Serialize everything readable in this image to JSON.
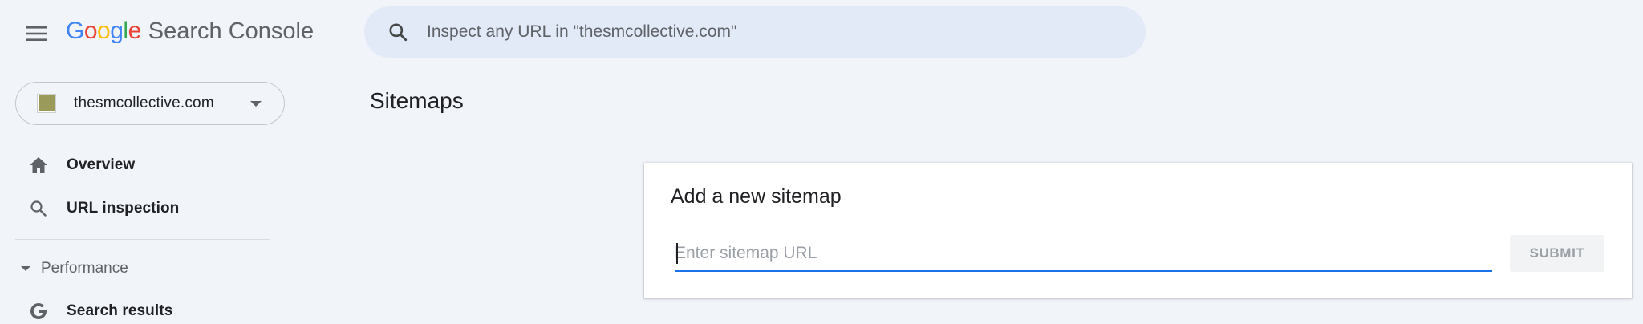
{
  "header": {
    "logo": {
      "letters": [
        {
          "ch": "G",
          "color": "#4285f4"
        },
        {
          "ch": "o",
          "color": "#ea4335"
        },
        {
          "ch": "o",
          "color": "#fbbc05"
        },
        {
          "ch": "g",
          "color": "#4285f4"
        },
        {
          "ch": "l",
          "color": "#34a853"
        },
        {
          "ch": "e",
          "color": "#ea4335"
        }
      ],
      "product": "Search Console"
    },
    "search": {
      "placeholder": "Inspect any URL in \"thesmcollective.com\"",
      "value": ""
    },
    "menu_icon": "hamburger-menu-icon"
  },
  "sidebar": {
    "property": {
      "name": "thesmcollective.com",
      "swatch_color": "#9a9a5a"
    },
    "items": [
      {
        "label": "Overview",
        "icon": "home-icon"
      },
      {
        "label": "URL inspection",
        "icon": "search-icon"
      }
    ],
    "section": {
      "label": "Performance",
      "expanded": true
    },
    "section_items": [
      {
        "label": "Search results",
        "icon": "google-g-icon"
      }
    ]
  },
  "main": {
    "title": "Sitemaps",
    "card": {
      "title": "Add a new sitemap",
      "input_placeholder": "Enter sitemap URL",
      "input_value": "",
      "submit_label": "SUBMIT"
    }
  },
  "colors": {
    "background": "#f1f4f9",
    "search_bar": "#e3eaf7",
    "accent_blue": "#1a73e8",
    "text_primary": "#202124",
    "text_secondary": "#5f6368"
  }
}
